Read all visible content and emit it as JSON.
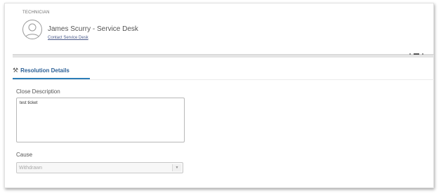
{
  "technician": {
    "section_label": "TECHNICIAN",
    "name": "James Scurry - Service Desk",
    "contact_link": "Contact Service Desk",
    "avatar_icon": "user-avatar-icon"
  },
  "tabs": [
    {
      "label": "Resolution Details",
      "icon": "wrench-cog-icon",
      "active": true
    }
  ],
  "form": {
    "close_description": {
      "label": "Close Description",
      "value": "test ticket"
    },
    "cause": {
      "label": "Cause",
      "selected": "Withdrawn",
      "icon": "chevron-down-icon"
    }
  },
  "colors": {
    "accent": "#2b7db7",
    "tab_text": "#2a5f96",
    "link": "#4a5a8a"
  }
}
